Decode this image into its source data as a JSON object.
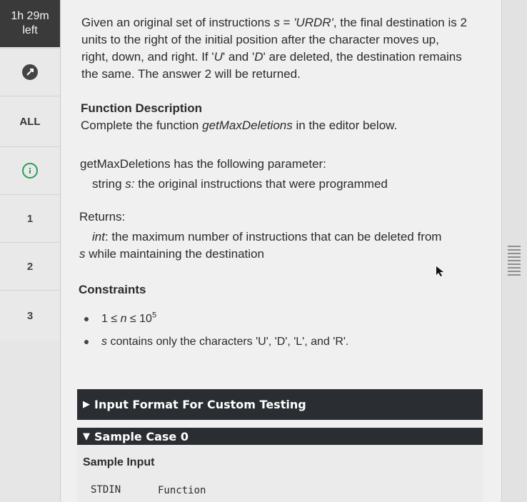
{
  "timer": {
    "line1": "1h 29m",
    "line2": "left"
  },
  "nav": [
    {
      "label": "ALL"
    },
    {
      "label": "1"
    },
    {
      "label": "2"
    },
    {
      "label": "3"
    }
  ],
  "intro": {
    "p1": "Given an original set of instructions ",
    "p1_var": "s",
    "p1_eq": " = ",
    "p1_val": "'URDR'",
    "p1_rest": ", the final destination is 2",
    "line2": "units to the right of the initial position after the character moves up,",
    "line3_a": "right, down, and right. If '",
    "line3_u": "U",
    "line3_b": "' and '",
    "line3_d": "D",
    "line3_c": "' are deleted, the destination remains",
    "line4": "the same. The answer 2 will be returned."
  },
  "function_description": {
    "heading": "Function Description",
    "text_a": "Complete the function ",
    "fn": "getMaxDeletions",
    "text_b": " in the editor below."
  },
  "parameters": {
    "intro": "getMaxDeletions has the following parameter:",
    "param_type": "string ",
    "param_name": "s:",
    "param_desc": " the original instructions that were programmed"
  },
  "returns": {
    "heading": "Returns:",
    "type": "int",
    "desc1": ": the maximum number of instructions that can be deleted from",
    "var": "s",
    "desc2": " while maintaining the destination"
  },
  "constraints": {
    "heading": "Constraints",
    "c1_a": "1 ≤ ",
    "c1_n": "n",
    "c1_b": " ≤ 10",
    "c1_exp": "5",
    "c2_var": "s",
    "c2_text": " contains only the characters 'U', 'D', 'L', and 'R'."
  },
  "sections": {
    "input_format": "Input Format For Custom Testing",
    "sample_case": "Sample Case 0",
    "sample_input": "Sample Input",
    "stdin": "STDIN",
    "function": "Function"
  },
  "colors": {
    "timer_bg": "#3a3a3a",
    "bar_bg": "#2a2d31",
    "success": "#2a9d58"
  }
}
